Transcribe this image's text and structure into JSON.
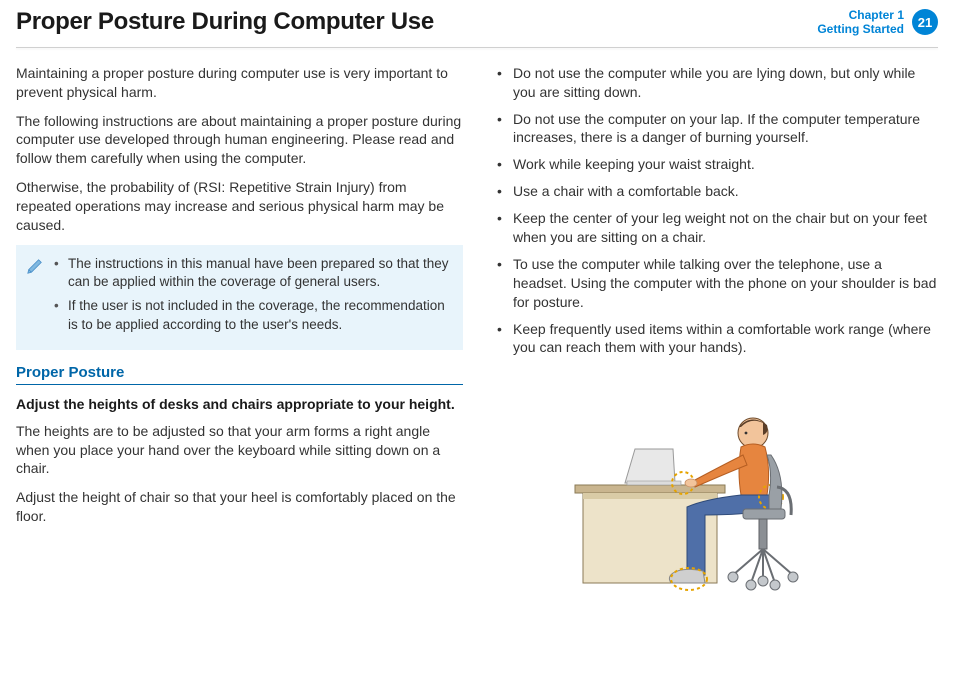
{
  "header": {
    "title": "Proper Posture During Computer Use",
    "chapter_line1": "Chapter 1",
    "chapter_line2": "Getting Started",
    "page_number": "21"
  },
  "left": {
    "p1": "Maintaining a proper posture during computer use is very important to prevent physical harm.",
    "p2": "The following instructions are about maintaining a proper posture during computer use developed through human engineering. Please read and follow them carefully when using the computer.",
    "p3": "Otherwise, the probability of (RSI: Repetitive Strain Injury) from repeated operations may increase and serious physical harm may be caused.",
    "note": {
      "items": [
        "The instructions in this manual have been prepared so that they can be applied within the coverage of general users.",
        "If the user is not included in the coverage, the recommendation is to be applied according to the user's needs."
      ]
    },
    "section_heading": "Proper Posture",
    "sub_heading": "Adjust the heights of desks and chairs appropriate to your height.",
    "p4": "The heights are to be adjusted so that your arm forms a right angle when you place your hand over the keyboard while sitting down on a chair.",
    "p5": "Adjust the height of chair so that your heel is comfortably placed on the floor."
  },
  "right": {
    "bullets": [
      "Do not use the computer while you are lying down, but only while you are sitting down.",
      "Do not use the computer on your lap. If the computer temperature increases, there is a danger of burning yourself.",
      "Work while keeping your waist straight.",
      "Use a chair with a comfortable back.",
      "Keep the center of your leg weight not on the chair but on your feet when you are sitting on a chair.",
      "To use the computer while talking over the telephone, use a headset. Using the computer with the phone on your shoulder is bad for posture.",
      "Keep frequently used items within a comfortable work range (where you can reach them with your hands)."
    ]
  }
}
